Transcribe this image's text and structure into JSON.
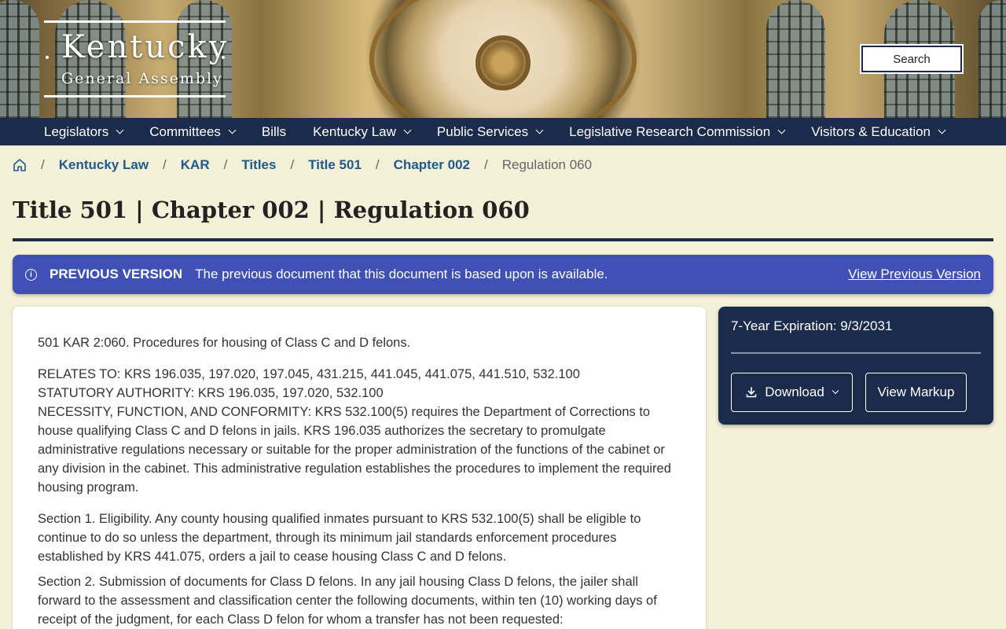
{
  "header": {
    "logo_title": "Kentucky",
    "logo_subtitle": "General Assembly",
    "search_label": "Search"
  },
  "nav": {
    "items": [
      {
        "label": "Legislators",
        "dropdown": true
      },
      {
        "label": "Committees",
        "dropdown": true
      },
      {
        "label": "Bills",
        "dropdown": false
      },
      {
        "label": "Kentucky Law",
        "dropdown": true
      },
      {
        "label": "Public Services",
        "dropdown": true
      },
      {
        "label": "Legislative Research Commission",
        "dropdown": true
      },
      {
        "label": "Visitors & Education",
        "dropdown": true
      }
    ]
  },
  "breadcrumb": {
    "home_icon": "home-icon",
    "links": [
      "Kentucky Law",
      "KAR",
      "Titles",
      "Title 501",
      "Chapter 002"
    ],
    "current": "Regulation 060",
    "separator": "/"
  },
  "page": {
    "title": "Title 501 | Chapter 002 | Regulation 060"
  },
  "alert": {
    "icon": "info-icon",
    "label": "PREVIOUS VERSION",
    "text": "The previous document that this document is based upon is available.",
    "link": "View Previous Version",
    "color": "#3f51b5"
  },
  "document": {
    "heading": "501 KAR 2:060.  Procedures for housing of Class C and D felons.",
    "relates_to": "RELATES TO:  KRS 196.035, 197.020, 197.045, 431.215, 441.045, 441.075, 441.510, 532.100",
    "statutory_authority": "STATUTORY AUTHORITY:  KRS 196.035, 197.020, 532.100",
    "necessity": "NECESSITY, FUNCTION, AND CONFORMITY:  KRS 532.100(5) requires the Department of Corrections to house qualifying Class C and D felons in jails. KRS 196.035 authorizes the secretary to promulgate administrative regulations necessary or suitable for the proper administration of the functions of the cabinet or any division in the cabinet. This administrative regulation establishes the procedures to implement the required housing program.",
    "section1": "Section 1.  Eligibility. Any county housing qualified inmates pursuant to KRS 532.100(5) shall be eligible to continue to do so unless the department, through its minimum jail standards enforcement procedures established by KRS 441.075, orders a jail to cease housing Class C and D felons.",
    "section2": "Section 2.  Submission of documents for Class D felons. In any jail housing Class D felons, the jailer shall forward to the assessment and classification center the following documents, within ten (10) working days of receipt of the judgment, for each Class D felon for whom a transfer has not been requested:"
  },
  "sidebar": {
    "expiration": "7-Year Expiration: 9/3/2031",
    "download_label": "Download",
    "view_markup_label": "View Markup"
  },
  "colors": {
    "navy": "#1b2b4b",
    "page_background": "#f5f0d8",
    "link": "#1e5a8c"
  }
}
